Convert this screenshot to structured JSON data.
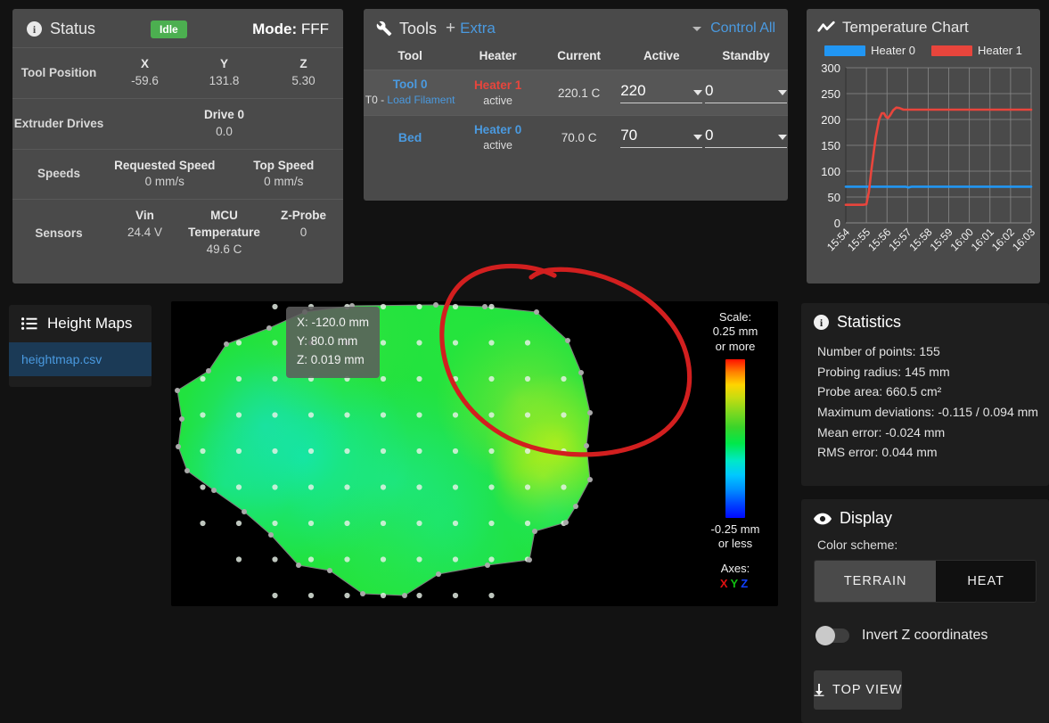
{
  "status": {
    "title": "Status",
    "badge": "Idle",
    "mode_label": "Mode:",
    "mode_value": "FFF",
    "rows": [
      {
        "label": "Tool Position",
        "cells": [
          {
            "k": "X",
            "v": "-59.6"
          },
          {
            "k": "Y",
            "v": "131.8"
          },
          {
            "k": "Z",
            "v": "5.30"
          }
        ]
      },
      {
        "label": "Extruder Drives",
        "cells": [
          {
            "k": "Drive 0",
            "v": "0.0"
          }
        ]
      },
      {
        "label": "Speeds",
        "cells": [
          {
            "k": "Requested Speed",
            "v": "0 mm/s"
          },
          {
            "k": "Top Speed",
            "v": "0 mm/s"
          }
        ]
      },
      {
        "label": "Sensors",
        "cells": [
          {
            "k": "Vin",
            "v": "24.4 V"
          },
          {
            "k": "MCU Temperature",
            "v": "49.6 C"
          },
          {
            "k": "Z-Probe",
            "v": "0"
          }
        ]
      }
    ]
  },
  "tools": {
    "title": "Tools",
    "plus": "+",
    "extra_label": "Extra",
    "control_all_label": "Control All",
    "columns": [
      "Tool",
      "Heater",
      "Current",
      "Active",
      "Standby"
    ],
    "rows": [
      {
        "tool_name": "Tool 0",
        "tool_sub_prefix": "T0 - ",
        "tool_sub_link": "Load Filament",
        "heater_name": "Heater 1",
        "heater_state": "active",
        "current": "220.1 C",
        "active": "220",
        "standby": "0"
      },
      {
        "tool_name": "Bed",
        "tool_sub_prefix": "",
        "tool_sub_link": "",
        "heater_name": "Heater 0",
        "heater_state": "active",
        "current": "70.0 C",
        "active": "70",
        "standby": "0"
      }
    ]
  },
  "chart": {
    "title": "Temperature Chart"
  },
  "chart_data": {
    "type": "line",
    "title": "Temperature Chart",
    "xlabel": "",
    "ylabel": "",
    "ylim": [
      0,
      300
    ],
    "yticks": [
      0,
      50,
      100,
      150,
      200,
      250,
      300
    ],
    "xticks": [
      "15:54",
      "15:55",
      "15:56",
      "15:57",
      "15:58",
      "15:59",
      "16:00",
      "16:01",
      "16:02",
      "16:03"
    ],
    "grid": true,
    "legend_position": "top",
    "legend": [
      "Heater 0",
      "Heater 1"
    ],
    "colors": {
      "Heater 0": "#2196f3",
      "Heater 1": "#e8453c"
    },
    "series": [
      {
        "name": "Heater 0",
        "color": "#2196f3",
        "x": [
          "15:54",
          "15:55",
          "15:56",
          "15:57",
          "15:58",
          "15:59",
          "16:00",
          "16:01",
          "16:02",
          "16:03"
        ],
        "values": [
          70,
          70,
          70,
          69,
          70,
          70,
          70,
          70,
          70,
          70
        ]
      },
      {
        "name": "Heater 1",
        "color": "#e8453c",
        "x": [
          "15:54",
          "15:55",
          "15:56",
          "15:57",
          "15:58",
          "15:59",
          "16:00",
          "16:01",
          "16:02",
          "16:03"
        ],
        "values": [
          35,
          36,
          212,
          203,
          222,
          219,
          219,
          219,
          219,
          219
        ]
      }
    ]
  },
  "heightmaps": {
    "title": "Height Maps",
    "items": [
      "heightmap.csv"
    ]
  },
  "map": {
    "tooltip": {
      "x": "X: -120.0 mm",
      "y": "Y: 80.0 mm",
      "z": "Z: 0.019 mm"
    },
    "scale_title": "Scale:",
    "scale_top": "0.25 mm\nor more",
    "scale_top_line1": "0.25 mm",
    "scale_top_line2": "or more",
    "scale_bottom_line1": "-0.25 mm",
    "scale_bottom_line2": "or less",
    "axes_title": "Axes:",
    "axis_x": "X",
    "axis_y": "Y",
    "axis_z": "Z"
  },
  "statistics": {
    "title": "Statistics",
    "lines": [
      "Number of points: 155",
      "Probing radius: 145 mm",
      "Probe area: 660.5 cm²",
      "Maximum deviations: -0.115 / 0.094 mm",
      "Mean error: -0.024 mm",
      "RMS error: 0.044 mm"
    ]
  },
  "display": {
    "title": "Display",
    "color_scheme_label": "Color scheme:",
    "scheme_options": [
      "TERRAIN",
      "HEAT"
    ],
    "scheme_selected": "TERRAIN",
    "invert_label": "Invert Z coordinates",
    "invert_on": false,
    "top_view_label": "TOP VIEW"
  },
  "colors": {
    "accent_blue": "#4a9ae0",
    "heater1_red": "#e8453c",
    "idle_green": "#4caf50",
    "panel_bg": "#4a4a4a",
    "dark_panel_bg": "#1e1e1e",
    "page_bg": "#121212",
    "annotation_red": "#d21f1f"
  }
}
